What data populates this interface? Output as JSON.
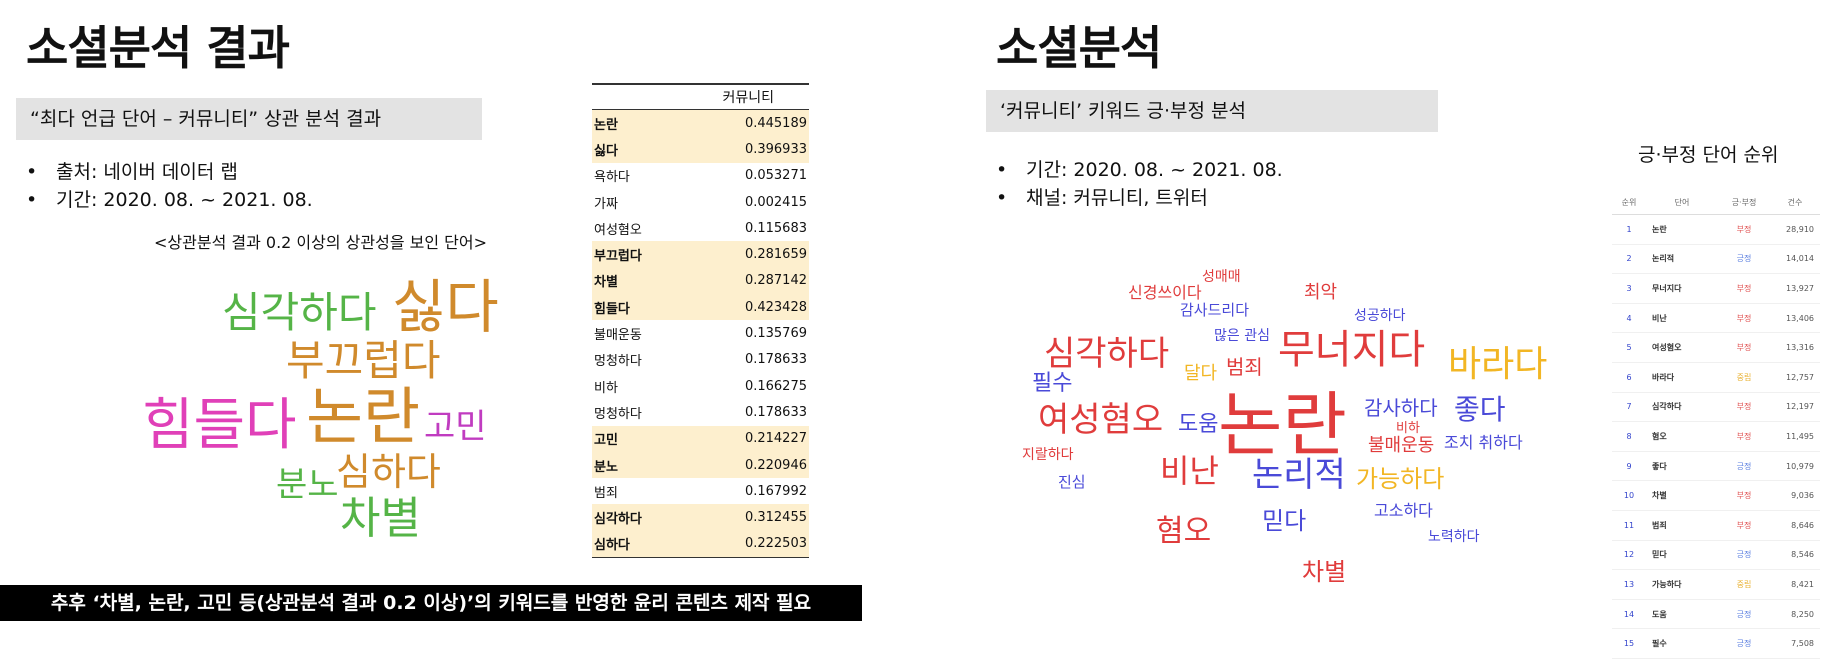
{
  "left": {
    "title": "소셜분석 결과",
    "box_label": "“최다 언급 단어 – 커뮤니티” 상관 분석 결과",
    "bullets": [
      "출처: 네이버 데이터 랩",
      "기간: 2020. 08. ~ 2021. 08."
    ],
    "caption": "<상관분석 결과 0.2 이상의 상관성을 보인 단어>",
    "table": {
      "header": "커뮤니티",
      "rows": [
        {
          "word": "논란",
          "value": "0.445189",
          "highlight": true
        },
        {
          "word": "싫다",
          "value": "0.396933",
          "highlight": true
        },
        {
          "word": "욕하다",
          "value": "0.053271",
          "highlight": false
        },
        {
          "word": "가짜",
          "value": "0.002415",
          "highlight": false
        },
        {
          "word": "여성혐오",
          "value": "0.115683",
          "highlight": false
        },
        {
          "word": "부끄럽다",
          "value": "0.281659",
          "highlight": true
        },
        {
          "word": "차별",
          "value": "0.287142",
          "highlight": true
        },
        {
          "word": "힘들다",
          "value": "0.423428",
          "highlight": true
        },
        {
          "word": "불매운동",
          "value": "0.135769",
          "highlight": false
        },
        {
          "word": "멍청하다",
          "value": "0.178633",
          "highlight": false
        },
        {
          "word": "비하",
          "value": "0.166275",
          "highlight": false
        },
        {
          "word": "멍청하다",
          "value": "0.178633",
          "highlight": false
        },
        {
          "word": "고민",
          "value": "0.214227",
          "highlight": true
        },
        {
          "word": "분노",
          "value": "0.220946",
          "highlight": true
        },
        {
          "word": "범죄",
          "value": "0.167992",
          "highlight": false
        },
        {
          "word": "심각하다",
          "value": "0.312455",
          "highlight": true
        },
        {
          "word": "심하다",
          "value": "0.222503",
          "highlight": true
        }
      ]
    },
    "cloud": {
      "w1": {
        "text": "심각하다",
        "color": "#55b447"
      },
      "w2": {
        "text": "싫다",
        "color": "#d08a2c"
      },
      "w3": {
        "text": "부끄럽다",
        "color": "#d08a2c"
      },
      "w4": {
        "text": "힘들다",
        "color": "#e040b8"
      },
      "w5": {
        "text": "논란",
        "color": "#d08a2c"
      },
      "w6": {
        "text": "고민",
        "color": "#c03cc0"
      },
      "w7": {
        "text": "분노",
        "color": "#55b447"
      },
      "w8": {
        "text": "심하다",
        "color": "#d08a2c"
      },
      "w9": {
        "text": "차별",
        "color": "#55b447"
      }
    },
    "footer": "추후 ‘차별, 논란, 고민 등(상관분석 결과 0.2 이상)’의 키워드를 반영한 윤리 콘텐츠 제작 필요"
  },
  "right": {
    "title": "소셜분석",
    "box_label": "‘커뮤니티’ 키워드 긍·부정 분석",
    "bullets": [
      "기간: 2020. 08. ~ 2021. 08.",
      "채널: 커뮤니티, 트위터"
    ],
    "cloud": {
      "c1": {
        "text": "성매매",
        "color": "#e03c3c"
      },
      "c2": {
        "text": "신경쓰이다",
        "color": "#e03c3c"
      },
      "c3": {
        "text": "최악",
        "color": "#e03c3c"
      },
      "c4": {
        "text": "감사드리다",
        "color": "#4a4ad8"
      },
      "c5": {
        "text": "성공하다",
        "color": "#4a4ad8"
      },
      "c6": {
        "text": "많은 관심",
        "color": "#4a4ad8"
      },
      "c7": {
        "text": "심각하다",
        "color": "#e03c3c"
      },
      "c8": {
        "text": "무너지다",
        "color": "#e03c3c"
      },
      "c9": {
        "text": "바라다",
        "color": "#f2b624"
      },
      "c10": {
        "text": "달다",
        "color": "#f2b624"
      },
      "c11": {
        "text": "범죄",
        "color": "#e03c3c"
      },
      "c12": {
        "text": "필수",
        "color": "#4a4ad8"
      },
      "c13": {
        "text": "여성혐오",
        "color": "#e03c3c"
      },
      "c14": {
        "text": "도움",
        "color": "#4a4ad8"
      },
      "c15": {
        "text": "논란",
        "color": "#e03c3c"
      },
      "c16": {
        "text": "감사하다",
        "color": "#4a4ad8"
      },
      "c17": {
        "text": "좋다",
        "color": "#4a4ad8"
      },
      "c18": {
        "text": "비하",
        "color": "#e03c3c"
      },
      "c19": {
        "text": "불매운동",
        "color": "#e03c3c"
      },
      "c20": {
        "text": "조치 취하다",
        "color": "#4a4ad8"
      },
      "c21": {
        "text": "지랄하다",
        "color": "#e03c3c"
      },
      "c22": {
        "text": "비난",
        "color": "#e03c3c"
      },
      "c23": {
        "text": "논리적",
        "color": "#4a4ad8"
      },
      "c24": {
        "text": "가능하다",
        "color": "#f2b624"
      },
      "c25": {
        "text": "진심",
        "color": "#4a4ad8"
      },
      "c26": {
        "text": "고소하다",
        "color": "#4a4ad8"
      },
      "c27": {
        "text": "혐오",
        "color": "#e03c3c"
      },
      "c28": {
        "text": "믿다",
        "color": "#4a4ad8"
      },
      "c29": {
        "text": "노력하다",
        "color": "#4a4ad8"
      },
      "c30": {
        "text": "차별",
        "color": "#e03c3c"
      }
    },
    "ranking": {
      "title": "긍·부정 단어 순위",
      "headers": [
        "순위",
        "단어",
        "긍·부정",
        "건수"
      ],
      "rows": [
        {
          "rank": "1",
          "word": "논란",
          "sentiment": "부정",
          "count": "28,910",
          "color": "#e05050"
        },
        {
          "rank": "2",
          "word": "논리적",
          "sentiment": "긍정",
          "count": "14,014",
          "color": "#5b7fe0"
        },
        {
          "rank": "3",
          "word": "무너지다",
          "sentiment": "부정",
          "count": "13,927",
          "color": "#e05050"
        },
        {
          "rank": "4",
          "word": "비난",
          "sentiment": "부정",
          "count": "13,406",
          "color": "#e05050"
        },
        {
          "rank": "5",
          "word": "여성혐오",
          "sentiment": "부정",
          "count": "13,316",
          "color": "#e05050"
        },
        {
          "rank": "6",
          "word": "바라다",
          "sentiment": "중립",
          "count": "12,757",
          "color": "#e8b030"
        },
        {
          "rank": "7",
          "word": "심각하다",
          "sentiment": "부정",
          "count": "12,197",
          "color": "#e05050"
        },
        {
          "rank": "8",
          "word": "혐오",
          "sentiment": "부정",
          "count": "11,495",
          "color": "#e05050"
        },
        {
          "rank": "9",
          "word": "좋다",
          "sentiment": "긍정",
          "count": "10,979",
          "color": "#5b7fe0"
        },
        {
          "rank": "10",
          "word": "차별",
          "sentiment": "부정",
          "count": "9,036",
          "color": "#e05050"
        },
        {
          "rank": "11",
          "word": "범죄",
          "sentiment": "부정",
          "count": "8,646",
          "color": "#e05050"
        },
        {
          "rank": "12",
          "word": "믿다",
          "sentiment": "긍정",
          "count": "8,546",
          "color": "#5b7fe0"
        },
        {
          "rank": "13",
          "word": "가능하다",
          "sentiment": "중립",
          "count": "8,421",
          "color": "#e8b030"
        },
        {
          "rank": "14",
          "word": "도움",
          "sentiment": "긍정",
          "count": "8,250",
          "color": "#5b7fe0"
        },
        {
          "rank": "15",
          "word": "필수",
          "sentiment": "긍정",
          "count": "7,508",
          "color": "#5b7fe0"
        }
      ]
    }
  }
}
